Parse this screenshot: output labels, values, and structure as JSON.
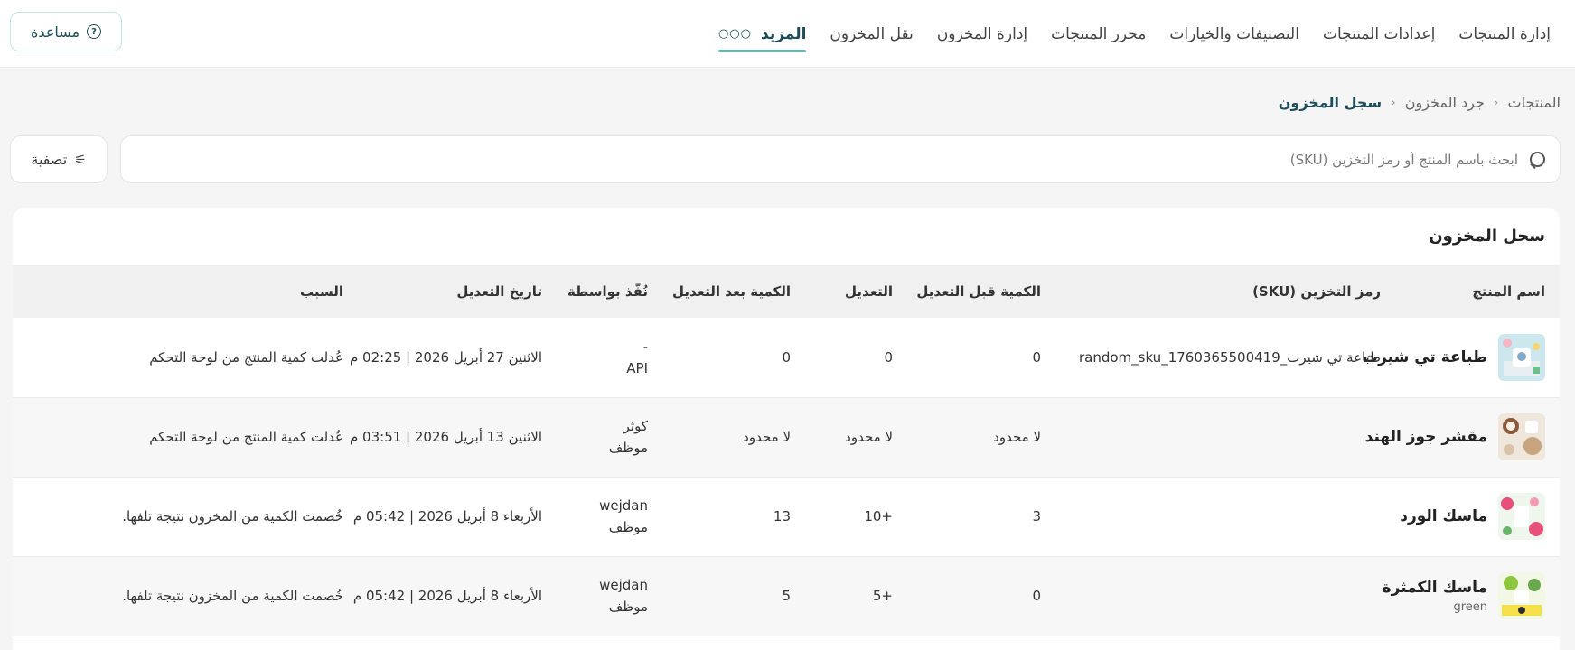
{
  "nav": {
    "items": [
      "إدارة المنتجات",
      "إعدادات المنتجات",
      "التصنيفات والخيارات",
      "محرر المنتجات",
      "إدارة المخزون",
      "نقل المخزون"
    ],
    "more_label": "المزيد",
    "more_icon": "more-dots-icon"
  },
  "help": {
    "label": "مساعدة",
    "icon": "help-circle-icon",
    "glyph": "?"
  },
  "breadcrumb": {
    "items": [
      "المنتجات",
      "جرد المخزون",
      "سجل المخزون"
    ],
    "separator": "‹"
  },
  "search": {
    "placeholder": "ابحث باسم المنتج أو رمز التخزين (SKU)",
    "value": ""
  },
  "filter": {
    "label": "تصفية",
    "icon": "sliders-icon",
    "glyph": "⚟"
  },
  "card": {
    "title": "سجل المخزون"
  },
  "table": {
    "headers": [
      "اسم المنتج",
      "رمز التخزين (SKU)",
      "الكمية قبل التعديل",
      "التعديل",
      "الكمية بعد التعديل",
      "نُفّذ بواسطة",
      "تاريخ التعديل",
      "السبب"
    ],
    "rows": [
      {
        "name": "طباعة تي شيرت",
        "variant": "",
        "sku": "طباعة تي شيرت_random_sku_1760365500419",
        "before": "0",
        "change": "0",
        "after": "0",
        "by_line1": "-",
        "by_line2": "API",
        "date": "الاثنين 27 أبريل 2026 | 02:25 م",
        "reason": "عُدلت كمية المنتج من لوحة التحكم"
      },
      {
        "name": "مقشر جوز الهند",
        "variant": "",
        "sku": "",
        "before": "لا محدود",
        "change": "لا محدود",
        "after": "لا محدود",
        "by_line1": "كوثر",
        "by_line2": "موظف",
        "date": "الاثنين 13 أبريل 2026 | 03:51 م",
        "reason": "عُدلت كمية المنتج من لوحة التحكم"
      },
      {
        "name": "ماسك الورد",
        "variant": "",
        "sku": "",
        "before": "3",
        "change": "+10",
        "after": "13",
        "by_line1": "wejdan",
        "by_line2": "موظف",
        "date": "الأربعاء 8 أبريل 2026 | 05:42 م",
        "reason": "خُصمت الكمية من المخزون نتيجة تلفها."
      },
      {
        "name": "ماسك الكمثرة",
        "variant": "green",
        "sku": "",
        "before": "0",
        "change": "+5",
        "after": "5",
        "by_line1": "wejdan",
        "by_line2": "موظف",
        "date": "الأربعاء 8 أبريل 2026 | 05:42 م",
        "reason": "خُصمت الكمية من المخزون نتيجة تلفها."
      }
    ]
  },
  "colors": {
    "accent": "#1e4d5a",
    "underline": "#5fb8b0",
    "help_border": "#bfe9e2"
  }
}
